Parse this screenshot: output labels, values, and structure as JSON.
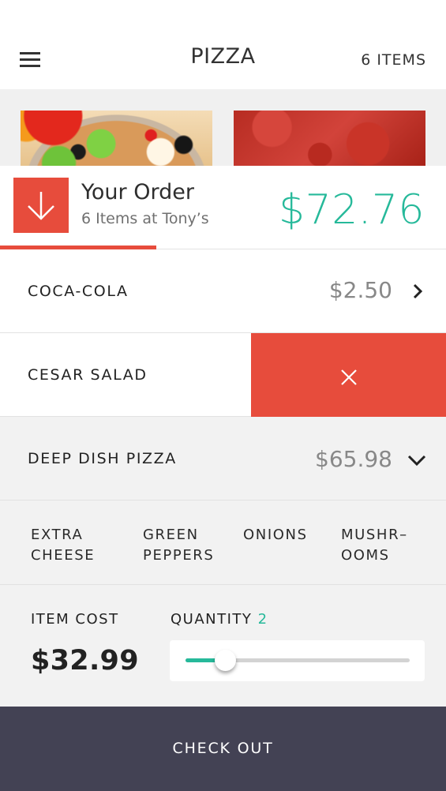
{
  "header": {
    "menu_icon": "hamburger-menu-icon",
    "title": "PIZZA",
    "item_count": "6 ITEMS"
  },
  "gallery": {
    "images": [
      {
        "name": "pizza-photo",
        "alt": "Pizza with peppers and olives"
      },
      {
        "name": "tomato-sauce-photo",
        "alt": "Tomato sauce"
      }
    ]
  },
  "order": {
    "icon": "arrow-down-icon",
    "title": "Your Order",
    "subtitle": "6 Items at Tony’s",
    "total": "$72.76",
    "progress_fraction": 0.35
  },
  "items": [
    {
      "label": "COCA-COLA",
      "price": "$2.50",
      "icon": "chevron-right-icon"
    },
    {
      "label": "CESAR SALAD",
      "delete_icon": "close-icon"
    },
    {
      "label": "DEEP DISH PIZZA",
      "price": "$65.98",
      "icon": "chevron-down-icon"
    }
  ],
  "toppings": [
    "EXTRA\nCHEESE",
    "GREEN\nPEPPERS",
    "ONIONS",
    "MUSHR–\nOOMS"
  ],
  "details": {
    "item_cost_label": "ITEM COST",
    "item_cost": "$32.99",
    "quantity_label": "QUANTITY",
    "quantity": "2",
    "slider_fraction": 0.175
  },
  "checkout": {
    "label": "CHECK OUT"
  },
  "colors": {
    "accent_red": "#e74c3c",
    "accent_teal": "#26b99a",
    "checkout_bg": "#434254"
  }
}
